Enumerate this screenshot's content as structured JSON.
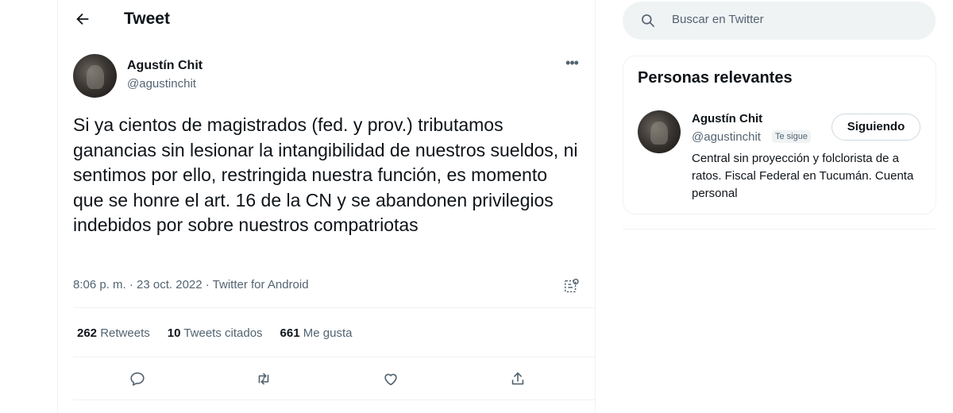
{
  "header": {
    "title": "Tweet",
    "back_icon": "arrow-left-icon"
  },
  "tweet": {
    "author_name": "Agustín Chit",
    "author_handle": "@agustinchit",
    "text": "Si ya cientos de magistrados (fed. y prov.) tributamos ganancias sin lesionar la intangibilidad de nuestros sueldos, ni sentimos por ello, restringida nuestra función, es momento que se honre el art. 16 de la CN y se abandonen privilegios indebidos por sobre nuestros compatriotas",
    "meta": "8:06 p. m. · 23 oct. 2022 · Twitter for Android",
    "stats": {
      "retweets_count": "262",
      "retweets_label": "Retweets",
      "quotes_count": "10",
      "quotes_label": "Tweets citados",
      "likes_count": "661",
      "likes_label": "Me gusta"
    },
    "actions": [
      "reply-icon",
      "retweet-icon",
      "like-icon",
      "share-icon"
    ]
  },
  "search": {
    "placeholder": "Buscar en Twitter"
  },
  "relevant_people": {
    "title": "Personas relevantes",
    "person": {
      "name": "Agustín Chit",
      "handle": "@agustinchit",
      "badge": "Te sigue",
      "follow_button": "Siguiendo",
      "bio": "Central sin proyección y folclorista de a ratos. Fiscal Federal en Tucumán. Cuenta personal"
    }
  },
  "colors": {
    "text": "#0f1419",
    "secondary": "#536471",
    "border": "#eff3f4"
  }
}
